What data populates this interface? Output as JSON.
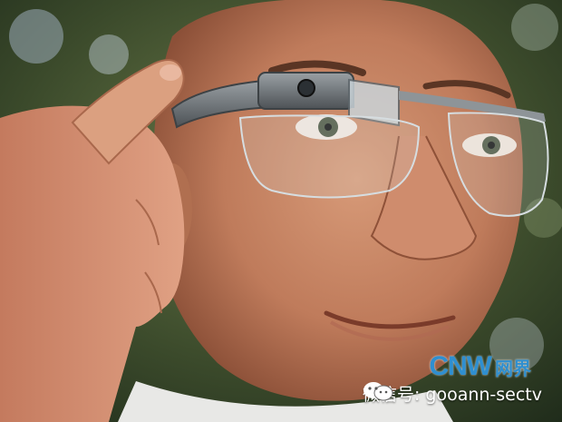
{
  "photo": {
    "subject": "man-wearing-smart-glasses"
  },
  "watermark": {
    "logo_latin": "CNW",
    "logo_cjk": "网界",
    "wechat_text": "微信号: gooann-sectv",
    "icon": "wechat-icon"
  },
  "colors": {
    "logo_blue": "#2f8fd0",
    "glasses_frame": "#6e7378",
    "skin": "#c98a6a"
  }
}
